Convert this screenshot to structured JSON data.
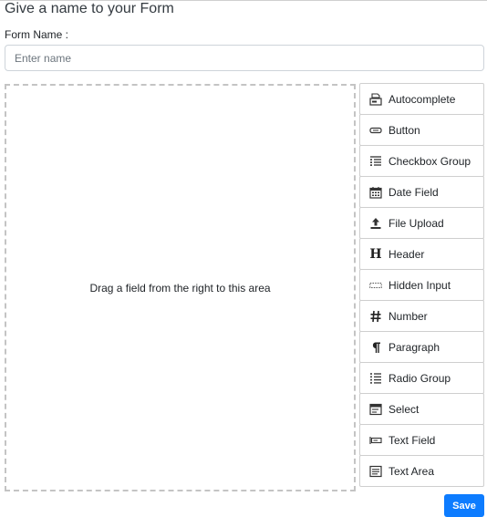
{
  "form": {
    "title": "Give a name to your Form",
    "name_label": "Form Name :",
    "name_placeholder": "Enter name",
    "name_value": ""
  },
  "dropzone": {
    "message": "Drag a field from the right to this area"
  },
  "palette": {
    "items": [
      {
        "label": "Autocomplete",
        "icon": "autocomplete-icon"
      },
      {
        "label": "Button",
        "icon": "button-icon"
      },
      {
        "label": "Checkbox Group",
        "icon": "checkbox-group-icon"
      },
      {
        "label": "Date Field",
        "icon": "calendar-icon"
      },
      {
        "label": "File Upload",
        "icon": "upload-icon"
      },
      {
        "label": "Header",
        "icon": "header-icon"
      },
      {
        "label": "Hidden Input",
        "icon": "hidden-input-icon"
      },
      {
        "label": "Number",
        "icon": "hash-icon"
      },
      {
        "label": "Paragraph",
        "icon": "paragraph-icon"
      },
      {
        "label": "Radio Group",
        "icon": "radio-group-icon"
      },
      {
        "label": "Select",
        "icon": "select-icon"
      },
      {
        "label": "Text Field",
        "icon": "text-field-icon"
      },
      {
        "label": "Text Area",
        "icon": "text-area-icon"
      }
    ]
  },
  "actions": {
    "save_label": "Save"
  },
  "colors": {
    "primary": "#0d7cff",
    "border": "#cfcfcf",
    "dropzone_border": "#c4c4c4"
  }
}
